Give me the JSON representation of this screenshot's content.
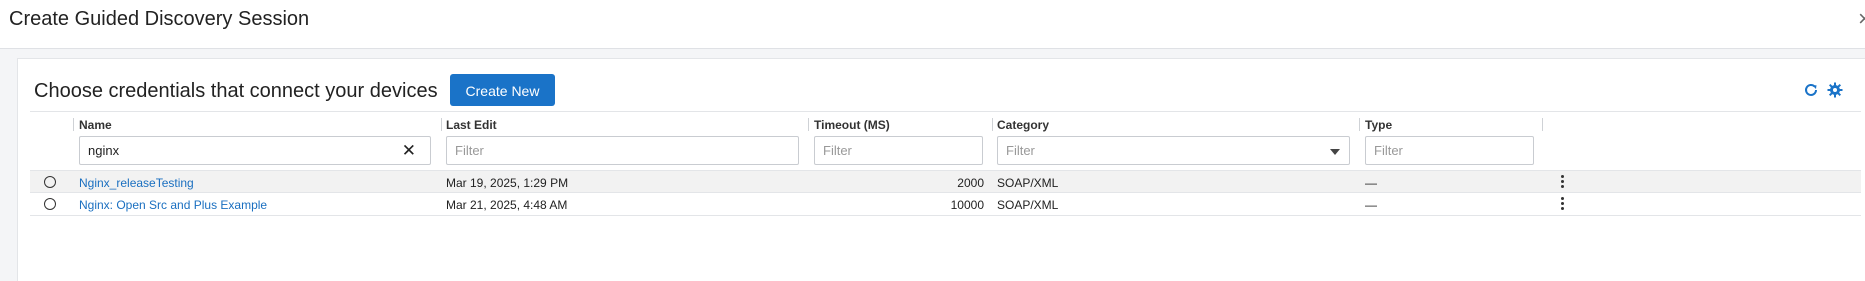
{
  "dialog": {
    "title": "Create Guided Discovery Session",
    "close_glyph": "×"
  },
  "panel": {
    "title": "Choose credentials that connect your devices",
    "create_label": "Create New",
    "accent_color": "#1a73c8"
  },
  "table": {
    "columns": [
      "Name",
      "Last Edit",
      "Timeout (MS)",
      "Category",
      "Type"
    ],
    "filters": {
      "name_value": "nginx",
      "last_edit_placeholder": "Filter",
      "timeout_placeholder": "Filter",
      "category_placeholder": "Filter",
      "type_placeholder": "Filter"
    },
    "rows": [
      {
        "name": "Nginx_releaseTesting",
        "last_edit": "Mar 19, 2025, 1:29 PM",
        "timeout": "2000",
        "category": "SOAP/XML",
        "type": "—"
      },
      {
        "name": "Nginx: Open Src and Plus Example",
        "last_edit": "Mar 21, 2025, 4:48 AM",
        "timeout": "10000",
        "category": "SOAP/XML",
        "type": "—"
      }
    ]
  }
}
